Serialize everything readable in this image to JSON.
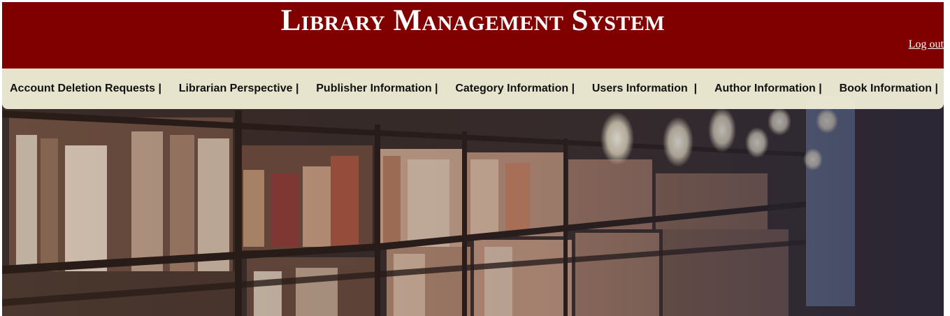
{
  "header": {
    "title": "Library Management System",
    "logout_label": "Log out",
    "background_color": "#800000"
  },
  "nav": {
    "separator": "|",
    "items": [
      {
        "label": "Account Deletion Requests"
      },
      {
        "label": "Librarian Perspective"
      },
      {
        "label": "Publisher Information"
      },
      {
        "label": "Category Information"
      },
      {
        "label": "Users Information"
      },
      {
        "label": "Author Information"
      },
      {
        "label": "Book Information"
      }
    ]
  },
  "hero": {
    "image": "library-bookshelves-image"
  }
}
